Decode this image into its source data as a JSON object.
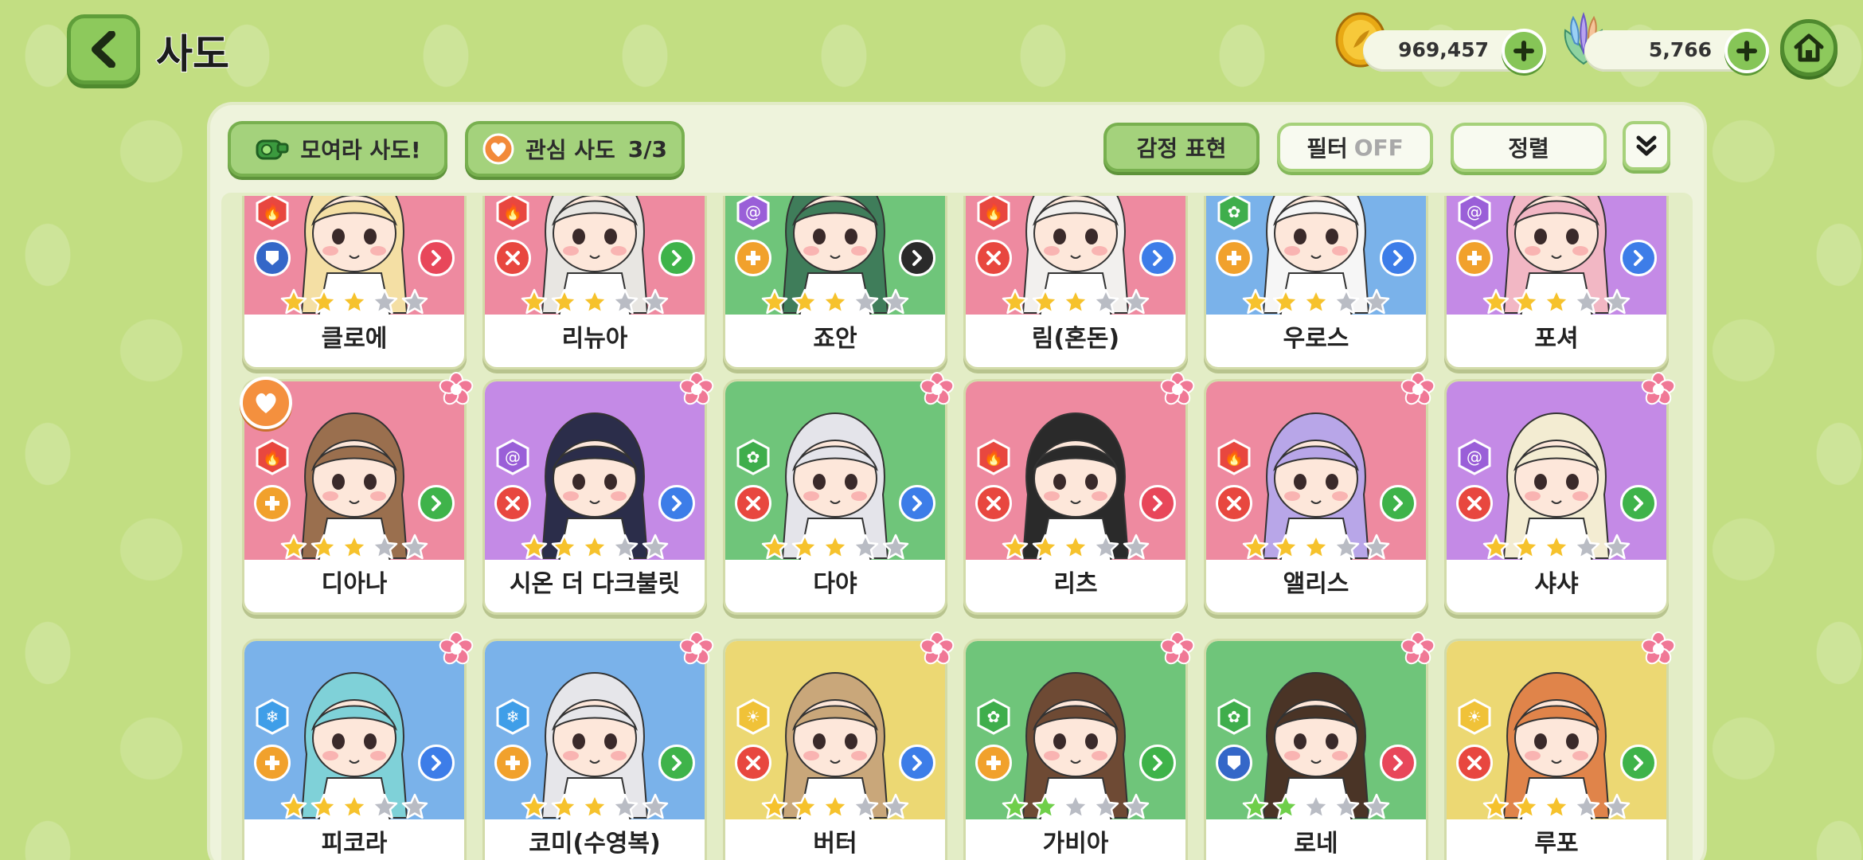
{
  "header": {
    "title": "사도",
    "gold_amount": "969,457",
    "gem_amount": "5,766"
  },
  "toolbar": {
    "gather_label": "모여라 사도!",
    "favorite_label": "관심 사도",
    "favorite_count": "3/3",
    "emote_label": "감정 표현",
    "filter_label": "필터",
    "filter_state": "OFF",
    "sort_label": "정렬"
  },
  "colors": {
    "pink": "#ee8aa0",
    "purple": "#c48ae6",
    "green": "#6fc57a",
    "blue": "#7ab2ea",
    "yellow": "#ecd873",
    "fire": "#e8473f",
    "arcane": "#9a5fd8",
    "nature": "#3fae4c",
    "ice": "#3f9ee8",
    "light": "#f0c238",
    "earth": "#3467c8"
  },
  "cards": [
    {
      "name": "클로에",
      "bg": "pink",
      "element": "fire",
      "role": "guard",
      "type": "red",
      "stars": 3,
      "flower": false,
      "favorite": false
    },
    {
      "name": "리뉴아",
      "bg": "pink",
      "element": "fire",
      "role": "attack",
      "type": "green",
      "stars": 3,
      "flower": false,
      "favorite": false
    },
    {
      "name": "죠안",
      "bg": "green",
      "element": "arcane",
      "role": "support",
      "type": "black",
      "stars": 3,
      "flower": false,
      "favorite": false
    },
    {
      "name": "림(혼돈)",
      "bg": "pink",
      "element": "fire",
      "role": "attack",
      "type": "blue",
      "stars": 3,
      "flower": false,
      "favorite": false
    },
    {
      "name": "우로스",
      "bg": "blue",
      "element": "nature",
      "role": "support",
      "type": "blue",
      "stars": 3,
      "flower": false,
      "favorite": false
    },
    {
      "name": "포셔",
      "bg": "purple",
      "element": "arcane",
      "role": "support",
      "type": "blue",
      "stars": 3,
      "flower": false,
      "favorite": false
    },
    {
      "name": "디아나",
      "bg": "pink",
      "element": "fire",
      "role": "support",
      "type": "green",
      "stars": 3,
      "flower": true,
      "favorite": true
    },
    {
      "name": "시온 더 다크불릿",
      "bg": "purple",
      "element": "arcane",
      "role": "attack",
      "type": "blue",
      "stars": 3,
      "flower": true,
      "favorite": false
    },
    {
      "name": "다야",
      "bg": "green",
      "element": "nature",
      "role": "attack",
      "type": "blue",
      "stars": 3,
      "flower": true,
      "favorite": false
    },
    {
      "name": "리츠",
      "bg": "pink",
      "element": "fire",
      "role": "attack",
      "type": "red",
      "stars": 3,
      "flower": true,
      "favorite": false
    },
    {
      "name": "앨리스",
      "bg": "pink",
      "element": "fire",
      "role": "attack",
      "type": "green",
      "stars": 3,
      "flower": true,
      "favorite": false
    },
    {
      "name": "샤샤",
      "bg": "purple",
      "element": "arcane",
      "role": "attack",
      "type": "green",
      "stars": 3,
      "flower": true,
      "favorite": false
    },
    {
      "name": "피코라",
      "bg": "blue",
      "element": "ice",
      "role": "support",
      "type": "blue",
      "stars": 3,
      "flower": true,
      "favorite": false
    },
    {
      "name": "코미(수영복)",
      "bg": "blue",
      "element": "ice",
      "role": "support",
      "type": "green",
      "stars": 3,
      "flower": true,
      "favorite": false
    },
    {
      "name": "버터",
      "bg": "yellow",
      "element": "light",
      "role": "attack",
      "type": "blue",
      "stars": 3,
      "flower": true,
      "favorite": false
    },
    {
      "name": "가비아",
      "bg": "green",
      "element": "nature",
      "role": "support",
      "type": "green",
      "stars": 2,
      "flower": true,
      "favorite": false
    },
    {
      "name": "로네",
      "bg": "green",
      "element": "nature",
      "role": "guard",
      "type": "red",
      "stars": 2,
      "flower": true,
      "favorite": false
    },
    {
      "name": "루포",
      "bg": "yellow",
      "element": "light",
      "role": "attack",
      "type": "green",
      "stars": 3,
      "flower": true,
      "favorite": false
    }
  ]
}
